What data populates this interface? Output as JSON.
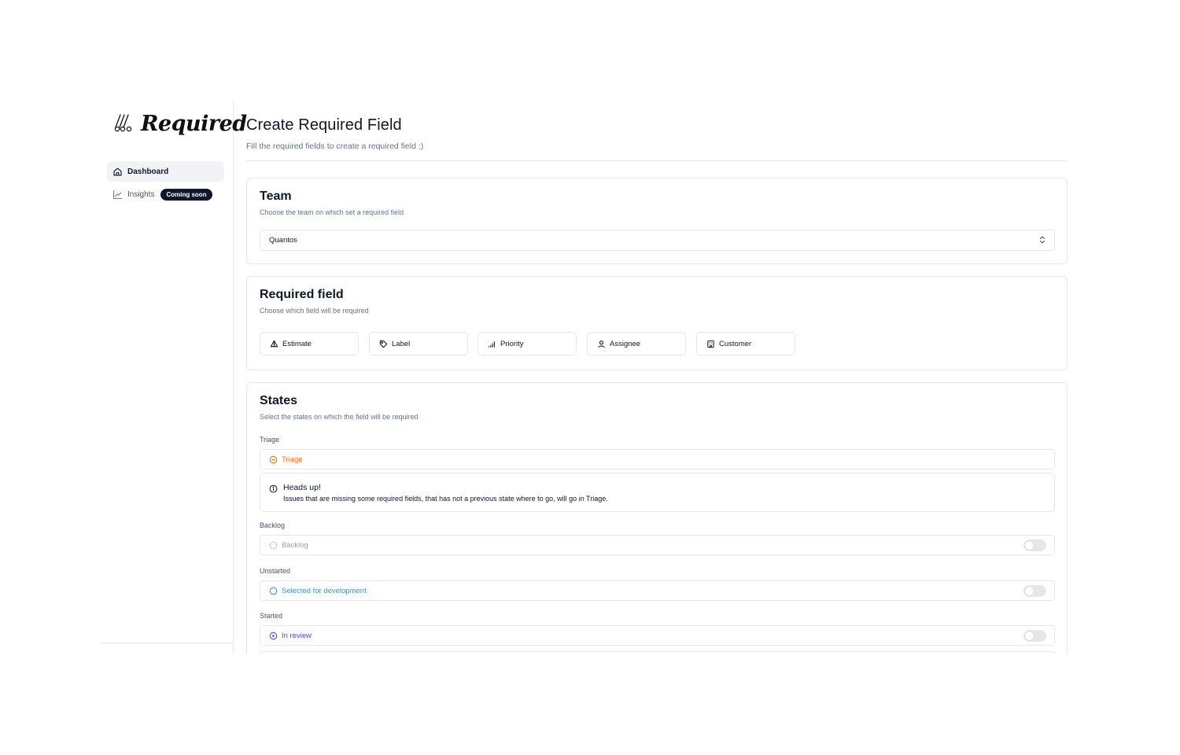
{
  "app": {
    "logo_text": "Required"
  },
  "sidebar": {
    "items": [
      {
        "label": "Dashboard",
        "icon": "home-icon",
        "active": true
      },
      {
        "label": "Insights",
        "icon": "line-chart-icon",
        "badge": "Coming soon"
      }
    ]
  },
  "page": {
    "title": "Create Required Field",
    "subtitle": "Fill the required fields to create a required field :)"
  },
  "team": {
    "title": "Team",
    "description": "Choose the team on which set a required field",
    "selected": "Quantos"
  },
  "required_field": {
    "title": "Required field",
    "description": "Choose which field will be required",
    "options": [
      {
        "label": "Estimate",
        "icon": "estimate-icon"
      },
      {
        "label": "Label",
        "icon": "tag-icon"
      },
      {
        "label": "Priority",
        "icon": "priority-bars-icon"
      },
      {
        "label": "Assignee",
        "icon": "user-icon"
      },
      {
        "label": "Customer",
        "icon": "building-icon"
      }
    ]
  },
  "states": {
    "title": "States",
    "description": "Select the states on which the field will be required",
    "groups": [
      {
        "label": "Triage",
        "items": [
          {
            "label": "Triage",
            "color": "#f97316"
          }
        ]
      },
      {
        "label": "Backlog",
        "items": [
          {
            "label": "Backlog",
            "color": "#9ca3af",
            "enabled": false
          }
        ]
      },
      {
        "label": "Unstarted",
        "items": [
          {
            "label": "Selected for development",
            "color": "#0ea5e9",
            "enabled": false
          }
        ]
      },
      {
        "label": "Started",
        "items": [
          {
            "label": "In review",
            "color": "#4f46e5",
            "enabled": false
          }
        ]
      }
    ],
    "alert": {
      "title": "Heads up!",
      "description": "Issues that are missing some required fields, that has not a previous state where to go, will go in Triage."
    }
  }
}
